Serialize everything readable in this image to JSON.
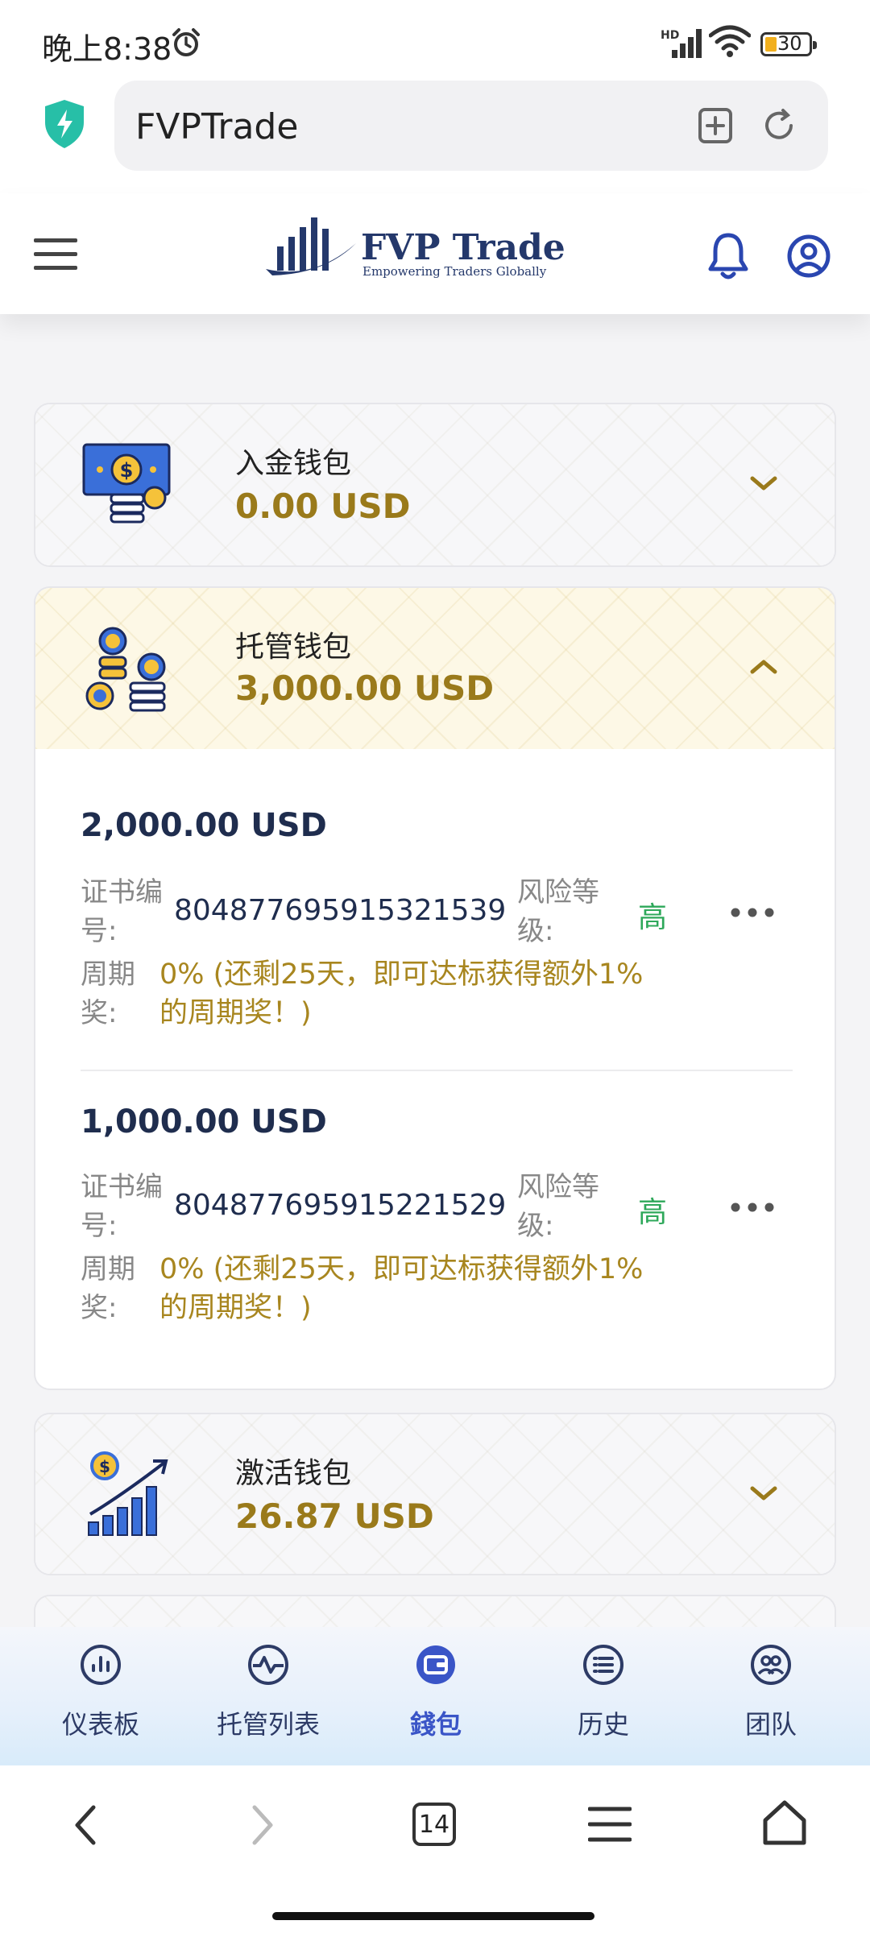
{
  "status_bar": {
    "time": "晚上8:38",
    "battery": "30",
    "network": "HD"
  },
  "browser": {
    "url_text": "FVPTrade",
    "tab_count": "14"
  },
  "header": {
    "logo_name": "FVP Trade",
    "logo_tagline": "Empowering Traders Globally"
  },
  "wallets": [
    {
      "title": "入金钱包",
      "amount": "0.00 USD",
      "expanded": false
    },
    {
      "title": "托管钱包",
      "amount": "3,000.00 USD",
      "expanded": true,
      "certificates": [
        {
          "amount": "2,000.00 USD",
          "cert_label": "证书编号:",
          "cert_no": "804877695915321539",
          "risk_label": "风险等级:",
          "risk": "高",
          "bonus_label": "周期奖:",
          "bonus": "0% (还剩25天，即可达标获得额外1%的周期奖！)"
        },
        {
          "amount": "1,000.00 USD",
          "cert_label": "证书编号:",
          "cert_no": "804877695915221529",
          "risk_label": "风险等级:",
          "risk": "高",
          "bonus_label": "周期奖:",
          "bonus": "0% (还剩25天，即可达标获得额外1%的周期奖！)"
        }
      ]
    },
    {
      "title": "激活钱包",
      "amount": "26.87 USD",
      "expanded": false
    }
  ],
  "bottom_nav": [
    {
      "label": "仪表板",
      "icon": "dashboard-icon",
      "active": false
    },
    {
      "label": "托管列表",
      "icon": "activity-icon",
      "active": false
    },
    {
      "label": "錢包",
      "icon": "wallet-icon",
      "active": true
    },
    {
      "label": "历史",
      "icon": "history-icon",
      "active": false
    },
    {
      "label": "团队",
      "icon": "team-icon",
      "active": false
    }
  ],
  "colors": {
    "accent_gold": "#9a7a1b",
    "navy": "#1f2d4e",
    "risk_green": "#2ea85a",
    "nav_active": "#3a55c7"
  }
}
